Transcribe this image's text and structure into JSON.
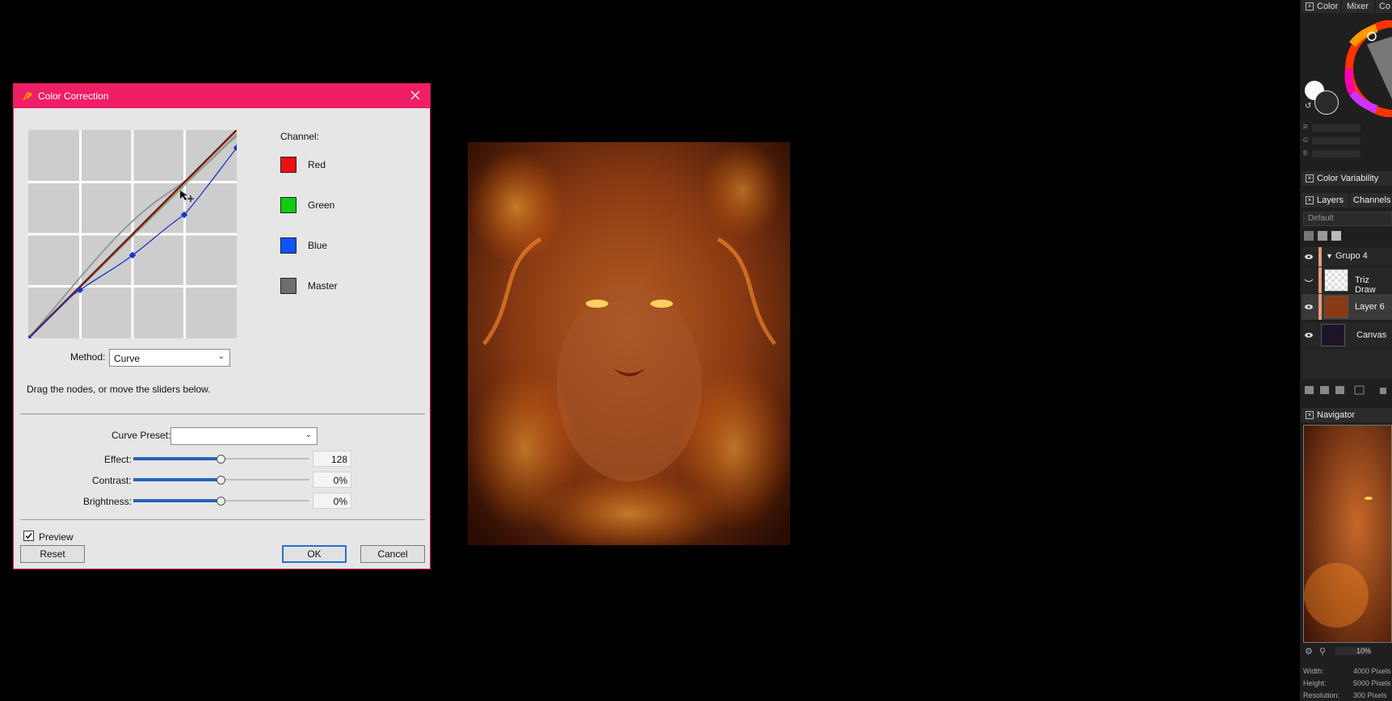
{
  "dialog": {
    "title": "Color Correction",
    "channel_label": "Channel:",
    "channels": [
      {
        "label": "Red",
        "color": "#ee1111"
      },
      {
        "label": "Green",
        "color": "#11cc11"
      },
      {
        "label": "Blue",
        "color": "#0a55ff"
      },
      {
        "label": "Master",
        "color": "#6e6e6e"
      }
    ],
    "method_label": "Method:",
    "method_value": "Curve",
    "hint": "Drag the nodes, or move the sliders below.",
    "curve_preset_label": "Curve Preset:",
    "curve_preset_value": "",
    "effect": {
      "label": "Effect:",
      "value": "128",
      "level": 0.5
    },
    "contrast": {
      "label": "Contrast:",
      "value": "0%",
      "level": 0.5
    },
    "brightness": {
      "label": "Brightness:",
      "value": "0%",
      "level": 0.5
    },
    "preview_label": "Preview",
    "preview_checked": true,
    "reset_label": "Reset",
    "ok_label": "OK",
    "cancel_label": "Cancel"
  },
  "panels": {
    "color_tabs": [
      "Color",
      "Mixer",
      "Co"
    ],
    "rgb_labels": [
      "R",
      "G",
      "B"
    ],
    "color_variability": "Color Variability",
    "layer_tabs": [
      "Layers",
      "Channels"
    ],
    "blend_mode": "Default",
    "layers": [
      {
        "name": "Grupo 4",
        "type": "group"
      },
      {
        "name": "Triz Draw",
        "type": "layer"
      },
      {
        "name": "Layer 6",
        "type": "layer",
        "selected": true
      },
      {
        "name": "Canvas",
        "type": "layer"
      }
    ],
    "navigator_title": "Navigator",
    "zoom": "10%",
    "info": [
      {
        "label": "Width:",
        "value": "4000 Pixels"
      },
      {
        "label": "Height:",
        "value": "5000 Pixels"
      },
      {
        "label": "Resolution:",
        "value": "300 Pixels"
      }
    ]
  }
}
